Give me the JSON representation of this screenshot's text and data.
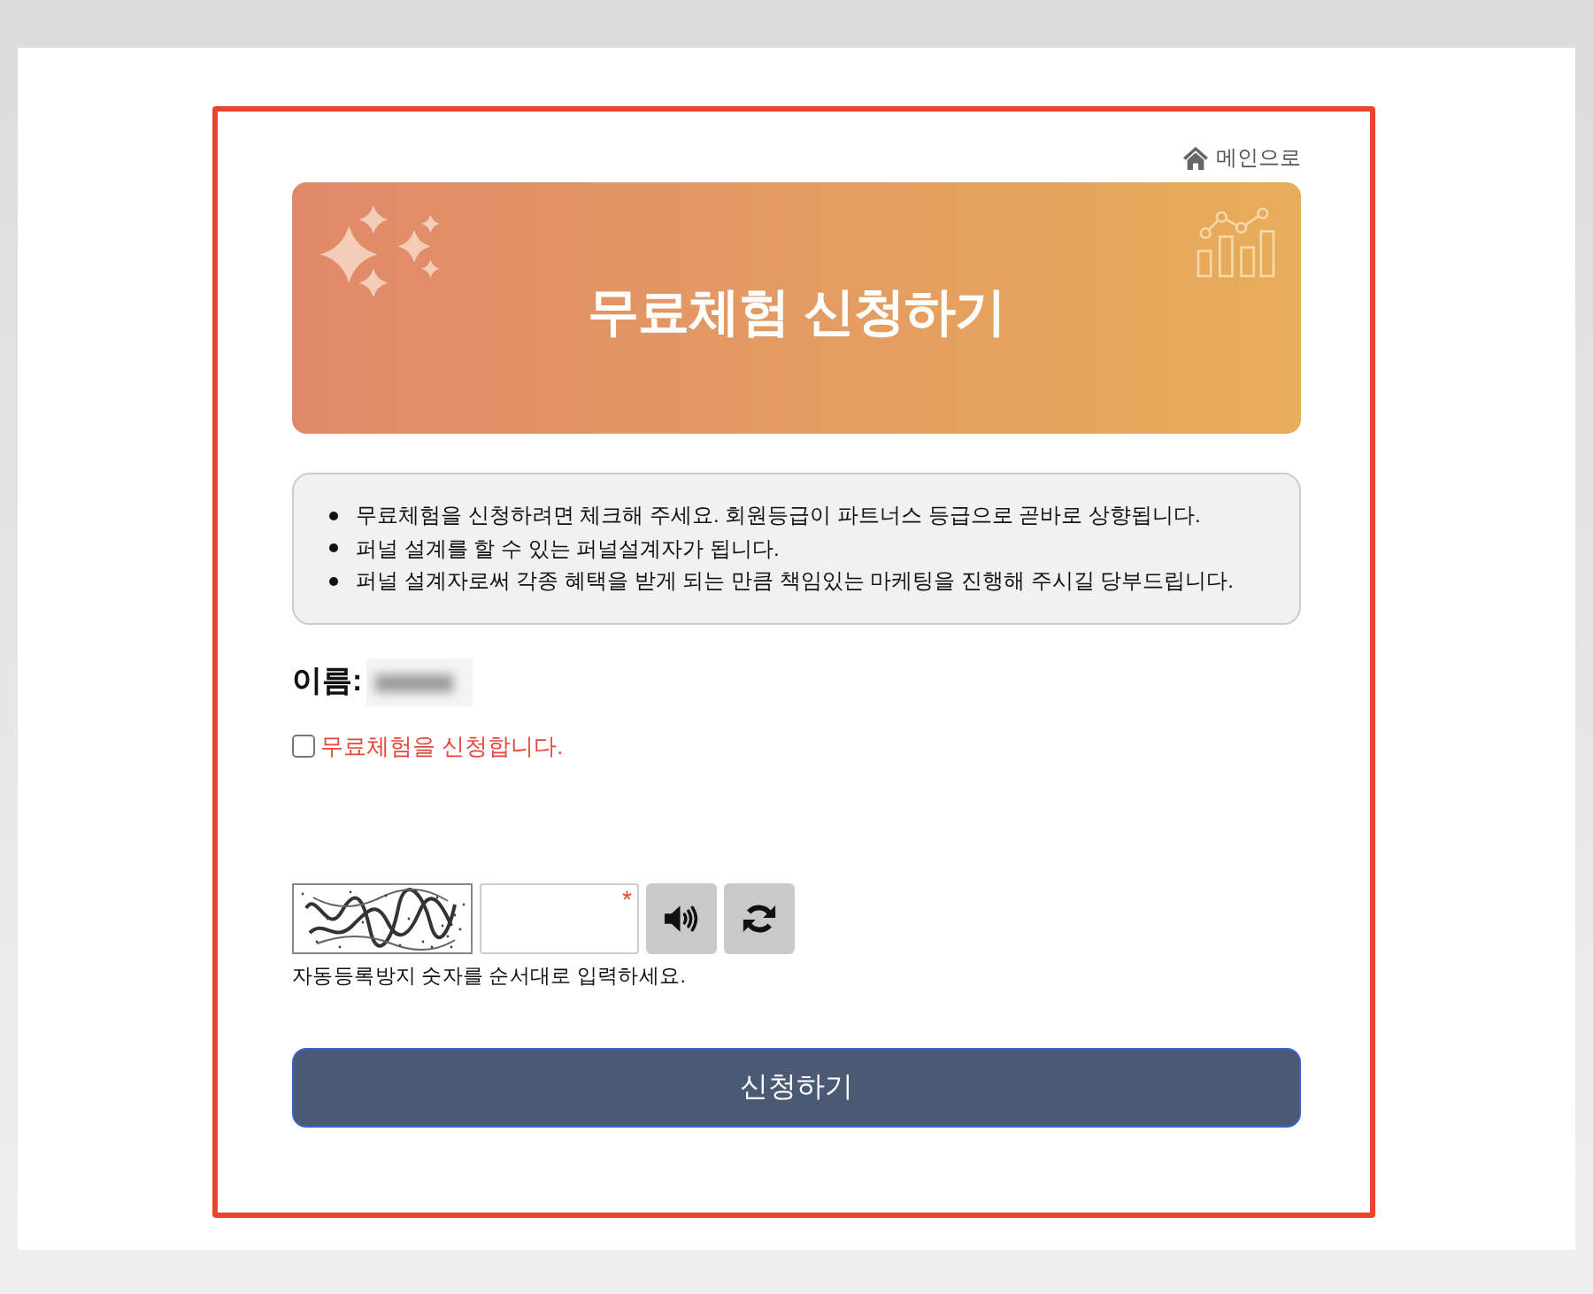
{
  "header": {
    "home_link": "메인으로"
  },
  "banner": {
    "title": "무료체험 신청하기"
  },
  "notice": {
    "items": [
      "무료체험을 신청하려면 체크해 주세요. 회원등급이 파트너스 등급으로 곧바로 상향됩니다.",
      "퍼널 설계를 할 수 있는 퍼널설계자가 됩니다.",
      "퍼널 설계자로써 각종 혜택을 받게 되는 만큼 책임있는 마케팅을 진행해 주시길 당부드립니다."
    ]
  },
  "name_field": {
    "label": "이름:"
  },
  "apply_checkbox": {
    "label": "무료체험을 신청합니다.",
    "checked": false
  },
  "captcha": {
    "required_mark": "*",
    "help": "자동등록방지 숫자를 순서대로 입력하세요."
  },
  "submit_button": {
    "label": "신청하기"
  }
}
